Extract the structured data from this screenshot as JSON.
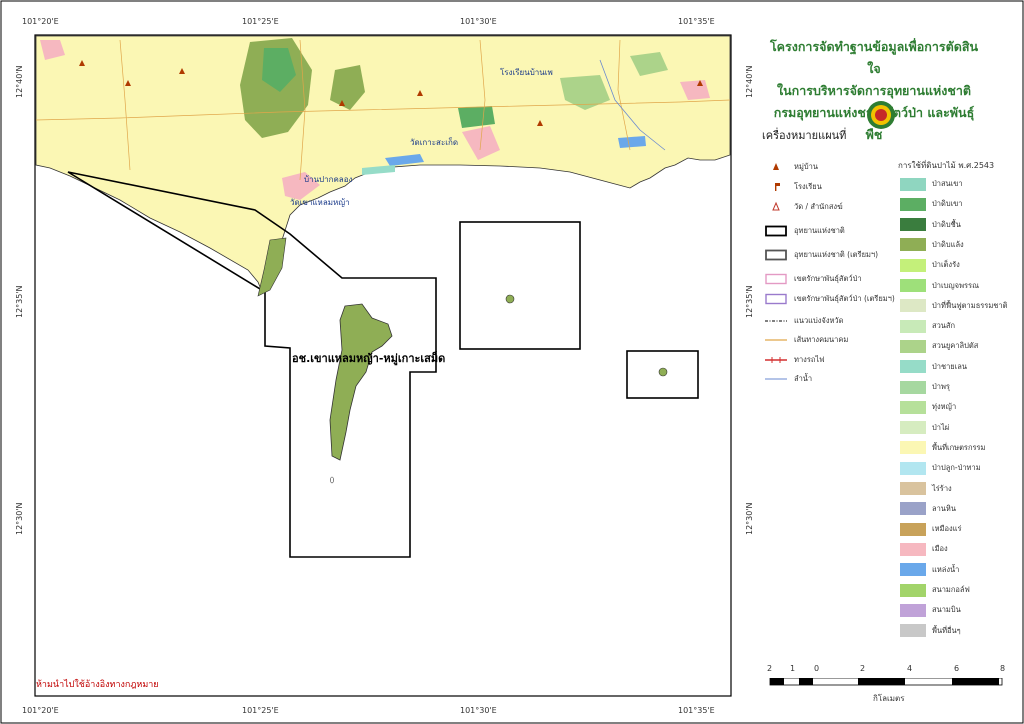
{
  "map": {
    "ticks": {
      "top": [
        "101°20'E",
        "101°25'E",
        "101°30'E",
        "101°35'E"
      ],
      "bottom": [
        "101°20'E",
        "101°25'E",
        "101°30'E",
        "101°35'E"
      ],
      "left": [
        "12°40'N",
        "12°35'N",
        "12°30'N"
      ],
      "right": [
        "12°40'N",
        "12°35'N",
        "12°30'N"
      ]
    },
    "places": [
      "วัดเขาแหลมหญ้า",
      "บ้านปากคลอง",
      "วัดเกาะสะเก็ด",
      "โรงเรียนบ้านเพ"
    ],
    "park_label": "อช.เขาแหลมหญ้า-หมู่เกาะเสม็ด",
    "warning": "ห้ามนำไปใช้อ้างอิงทางกฎหมาย"
  },
  "legend": {
    "title_lines": [
      "โครงการจัดทำฐานข้อมูลเพื่อการตัดสินใจ",
      "ในการบริหารจัดการอุทยานแห่งชาติ",
      "กรมอุทยานแห่งชาติ สัตว์ป่า และพันธุ์พืช"
    ],
    "heading": "เครื่องหมายแผนที่",
    "point_items": [
      {
        "label": "หมู่บ้าน",
        "icon": "village-triangle-icon"
      },
      {
        "label": "โรงเรียน",
        "icon": "school-flag-icon"
      },
      {
        "label": "วัด / สำนักสงฆ์",
        "icon": "temple-triangle-icon"
      },
      {
        "label": "อุทยานแห่งชาติ",
        "icon": "park-boundary-icon"
      },
      {
        "label": "อุทยานแห่งชาติ (เตรียมฯ)",
        "icon": "proposed-park-boundary-icon"
      },
      {
        "label": "เขตรักษาพันธุ์สัตว์ป่า",
        "icon": "wildlife-sanctuary-icon"
      },
      {
        "label": "เขตรักษาพันธุ์สัตว์ป่า (เตรียมฯ)",
        "icon": "proposed-sanctuary-icon"
      },
      {
        "label": "แนวแบ่งจังหวัด",
        "icon": "province-boundary-icon"
      },
      {
        "label": "เส้นทางคมนาคม",
        "icon": "road-line-icon"
      },
      {
        "label": "ทางรถไฟ",
        "icon": "railway-line-icon"
      },
      {
        "label": "ลำน้ำ",
        "icon": "river-line-icon"
      }
    ],
    "landuse_heading": "การใช้ที่ดินปาไม้ พ.ศ.2543",
    "landuse_items": [
      {
        "label": "ป่าสนเขา",
        "color": "#8fd6c0"
      },
      {
        "label": "ป่าดิบเขา",
        "color": "#5cae63"
      },
      {
        "label": "ป่าดิบชื้น",
        "color": "#3a7d3e"
      },
      {
        "label": "ป่าดิบแล้ง",
        "color": "#8fae55"
      },
      {
        "label": "ป่าเต็งรัง",
        "color": "#c4f07a"
      },
      {
        "label": "ป่าเบญจพรรณ",
        "color": "#9ee07a"
      },
      {
        "label": "ป่าที่ฟื้นฟูตามธรรมชาติ",
        "color": "#dde8c5"
      },
      {
        "label": "สวนสัก",
        "color": "#c8eab8"
      },
      {
        "label": "สวนยูคาลิปตัส",
        "color": "#acd38a"
      },
      {
        "label": "ป่าชายเลน",
        "color": "#96dcc8"
      },
      {
        "label": "ป่าพรุ",
        "color": "#a6d8a0"
      },
      {
        "label": "ทุ่งหญ้า",
        "color": "#b6e09a"
      },
      {
        "label": "ป่าไผ่",
        "color": "#d6ecc0"
      },
      {
        "label": "พื้นที่เกษตรกรรม",
        "color": "#fbf7b4"
      },
      {
        "label": "ป่าปลูก-ป่าทาม",
        "color": "#b2e6f0"
      },
      {
        "label": "ไร่ร้าง",
        "color": "#d9c39e"
      },
      {
        "label": "ลานหิน",
        "color": "#9aa2c8"
      },
      {
        "label": "เหมืองแร่",
        "color": "#c8a25a"
      },
      {
        "label": "เมือง",
        "color": "#f6b8c0"
      },
      {
        "label": "แหล่งน้ำ",
        "color": "#6aa8ea"
      },
      {
        "label": "สนามกอล์ฟ",
        "color": "#a2d46a"
      },
      {
        "label": "สนามบิน",
        "color": "#c0a2d8"
      },
      {
        "label": "พื้นที่อื่นๆ",
        "color": "#c8c8c8"
      }
    ],
    "scale": {
      "numbers": [
        "2",
        "1",
        "0",
        "2",
        "4",
        "6",
        "8"
      ],
      "unit": "กิโลเมตร"
    }
  }
}
